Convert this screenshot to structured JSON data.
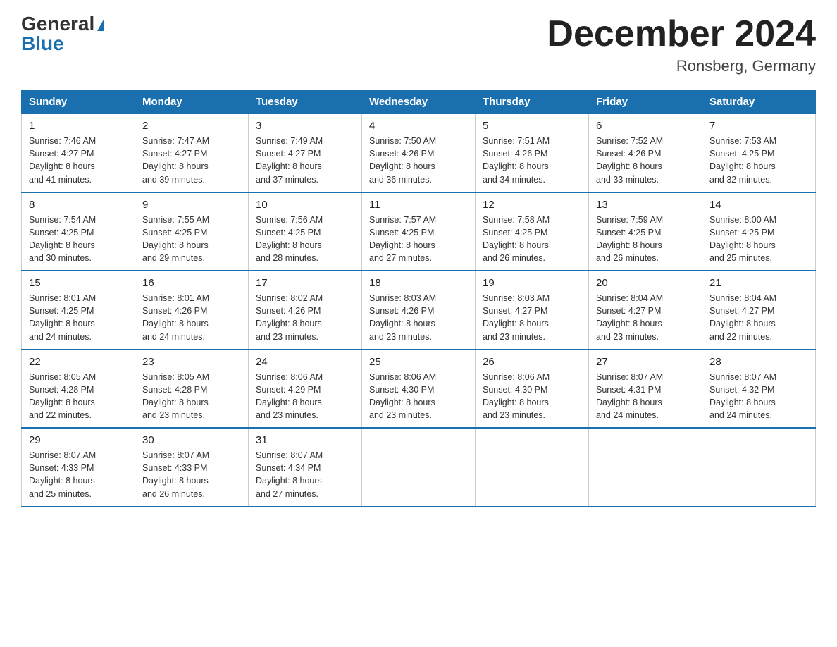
{
  "header": {
    "logo_general": "General",
    "logo_blue": "Blue",
    "title": "December 2024",
    "subtitle": "Ronsberg, Germany"
  },
  "days_of_week": [
    "Sunday",
    "Monday",
    "Tuesday",
    "Wednesday",
    "Thursday",
    "Friday",
    "Saturday"
  ],
  "weeks": [
    [
      {
        "num": "1",
        "sunrise": "7:46 AM",
        "sunset": "4:27 PM",
        "daylight": "8 hours and 41 minutes."
      },
      {
        "num": "2",
        "sunrise": "7:47 AM",
        "sunset": "4:27 PM",
        "daylight": "8 hours and 39 minutes."
      },
      {
        "num": "3",
        "sunrise": "7:49 AM",
        "sunset": "4:27 PM",
        "daylight": "8 hours and 37 minutes."
      },
      {
        "num": "4",
        "sunrise": "7:50 AM",
        "sunset": "4:26 PM",
        "daylight": "8 hours and 36 minutes."
      },
      {
        "num": "5",
        "sunrise": "7:51 AM",
        "sunset": "4:26 PM",
        "daylight": "8 hours and 34 minutes."
      },
      {
        "num": "6",
        "sunrise": "7:52 AM",
        "sunset": "4:26 PM",
        "daylight": "8 hours and 33 minutes."
      },
      {
        "num": "7",
        "sunrise": "7:53 AM",
        "sunset": "4:25 PM",
        "daylight": "8 hours and 32 minutes."
      }
    ],
    [
      {
        "num": "8",
        "sunrise": "7:54 AM",
        "sunset": "4:25 PM",
        "daylight": "8 hours and 30 minutes."
      },
      {
        "num": "9",
        "sunrise": "7:55 AM",
        "sunset": "4:25 PM",
        "daylight": "8 hours and 29 minutes."
      },
      {
        "num": "10",
        "sunrise": "7:56 AM",
        "sunset": "4:25 PM",
        "daylight": "8 hours and 28 minutes."
      },
      {
        "num": "11",
        "sunrise": "7:57 AM",
        "sunset": "4:25 PM",
        "daylight": "8 hours and 27 minutes."
      },
      {
        "num": "12",
        "sunrise": "7:58 AM",
        "sunset": "4:25 PM",
        "daylight": "8 hours and 26 minutes."
      },
      {
        "num": "13",
        "sunrise": "7:59 AM",
        "sunset": "4:25 PM",
        "daylight": "8 hours and 26 minutes."
      },
      {
        "num": "14",
        "sunrise": "8:00 AM",
        "sunset": "4:25 PM",
        "daylight": "8 hours and 25 minutes."
      }
    ],
    [
      {
        "num": "15",
        "sunrise": "8:01 AM",
        "sunset": "4:25 PM",
        "daylight": "8 hours and 24 minutes."
      },
      {
        "num": "16",
        "sunrise": "8:01 AM",
        "sunset": "4:26 PM",
        "daylight": "8 hours and 24 minutes."
      },
      {
        "num": "17",
        "sunrise": "8:02 AM",
        "sunset": "4:26 PM",
        "daylight": "8 hours and 23 minutes."
      },
      {
        "num": "18",
        "sunrise": "8:03 AM",
        "sunset": "4:26 PM",
        "daylight": "8 hours and 23 minutes."
      },
      {
        "num": "19",
        "sunrise": "8:03 AM",
        "sunset": "4:27 PM",
        "daylight": "8 hours and 23 minutes."
      },
      {
        "num": "20",
        "sunrise": "8:04 AM",
        "sunset": "4:27 PM",
        "daylight": "8 hours and 23 minutes."
      },
      {
        "num": "21",
        "sunrise": "8:04 AM",
        "sunset": "4:27 PM",
        "daylight": "8 hours and 22 minutes."
      }
    ],
    [
      {
        "num": "22",
        "sunrise": "8:05 AM",
        "sunset": "4:28 PM",
        "daylight": "8 hours and 22 minutes."
      },
      {
        "num": "23",
        "sunrise": "8:05 AM",
        "sunset": "4:28 PM",
        "daylight": "8 hours and 23 minutes."
      },
      {
        "num": "24",
        "sunrise": "8:06 AM",
        "sunset": "4:29 PM",
        "daylight": "8 hours and 23 minutes."
      },
      {
        "num": "25",
        "sunrise": "8:06 AM",
        "sunset": "4:30 PM",
        "daylight": "8 hours and 23 minutes."
      },
      {
        "num": "26",
        "sunrise": "8:06 AM",
        "sunset": "4:30 PM",
        "daylight": "8 hours and 23 minutes."
      },
      {
        "num": "27",
        "sunrise": "8:07 AM",
        "sunset": "4:31 PM",
        "daylight": "8 hours and 24 minutes."
      },
      {
        "num": "28",
        "sunrise": "8:07 AM",
        "sunset": "4:32 PM",
        "daylight": "8 hours and 24 minutes."
      }
    ],
    [
      {
        "num": "29",
        "sunrise": "8:07 AM",
        "sunset": "4:33 PM",
        "daylight": "8 hours and 25 minutes."
      },
      {
        "num": "30",
        "sunrise": "8:07 AM",
        "sunset": "4:33 PM",
        "daylight": "8 hours and 26 minutes."
      },
      {
        "num": "31",
        "sunrise": "8:07 AM",
        "sunset": "4:34 PM",
        "daylight": "8 hours and 27 minutes."
      },
      null,
      null,
      null,
      null
    ]
  ],
  "labels": {
    "sunrise": "Sunrise:",
    "sunset": "Sunset:",
    "daylight": "Daylight:"
  }
}
